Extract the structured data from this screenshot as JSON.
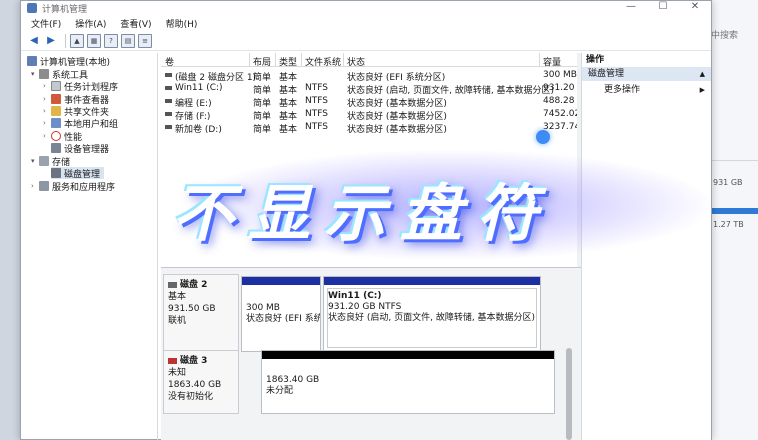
{
  "window": {
    "title": "计算机管理"
  },
  "menu": [
    "文件(F)",
    "操作(A)",
    "查看(V)",
    "帮助(H)"
  ],
  "background_window": {
    "search": "中搜索",
    "size_1": "931 GB",
    "size_2": "1.27 TB"
  },
  "tree": {
    "root": "计算机管理(本地)",
    "system_tools": "系统工具",
    "task_scheduler": "任务计划程序",
    "event_viewer": "事件查看器",
    "shared_folders": "共享文件夹",
    "local_users": "本地用户和组",
    "performance": "性能",
    "device_manager": "设备管理器",
    "storage": "存储",
    "disk_management": "磁盘管理",
    "services_apps": "服务和应用程序"
  },
  "volumes": {
    "headers": [
      "卷",
      "布局",
      "类型",
      "文件系统",
      "状态",
      "容量"
    ],
    "rows": [
      [
        "(磁盘 2 磁盘分区 1)",
        "简单",
        "基本",
        "",
        "状态良好 (EFI 系统分区)",
        "300 MB"
      ],
      [
        "Win11 (C:)",
        "简单",
        "基本",
        "NTFS",
        "状态良好 (启动, 页面文件, 故障转储, 基本数据分区)",
        "931.20 GB"
      ],
      [
        "编程 (E:)",
        "简单",
        "基本",
        "NTFS",
        "状态良好 (基本数据分区)",
        "488.28 G"
      ],
      [
        "存储 (F:)",
        "简单",
        "基本",
        "NTFS",
        "状态良好 (基本数据分区)",
        "7452.02"
      ],
      [
        "新加卷 (D:)",
        "简单",
        "基本",
        "NTFS",
        "状态良好 (基本数据分区)",
        "3237.74"
      ]
    ]
  },
  "actions": {
    "header": "操作",
    "section": "磁盘管理",
    "more": "更多操作"
  },
  "disk2": {
    "name": "磁盘 2",
    "type": "基本",
    "size": "931.50 GB",
    "status": "联机",
    "p1_size": "300 MB",
    "p1_status": "状态良好 (EFI 系统分",
    "p2_name": "Win11  (C:)",
    "p2_size": "931.20 GB NTFS",
    "p2_status": "状态良好 (启动, 页面文件, 故障转储, 基本数据分区)"
  },
  "disk3": {
    "name": "磁盘 3",
    "type": "未知",
    "size": "1863.40 GB",
    "status": "没有初始化",
    "p_size": "1863.40 GB",
    "p_status": "未分配"
  },
  "overlay": {
    "text": "不显示盘符"
  },
  "colors": {
    "primary_partition": "#1e2fa3",
    "unallocated": "#000000",
    "accent_dot": "#3e8bf5"
  }
}
